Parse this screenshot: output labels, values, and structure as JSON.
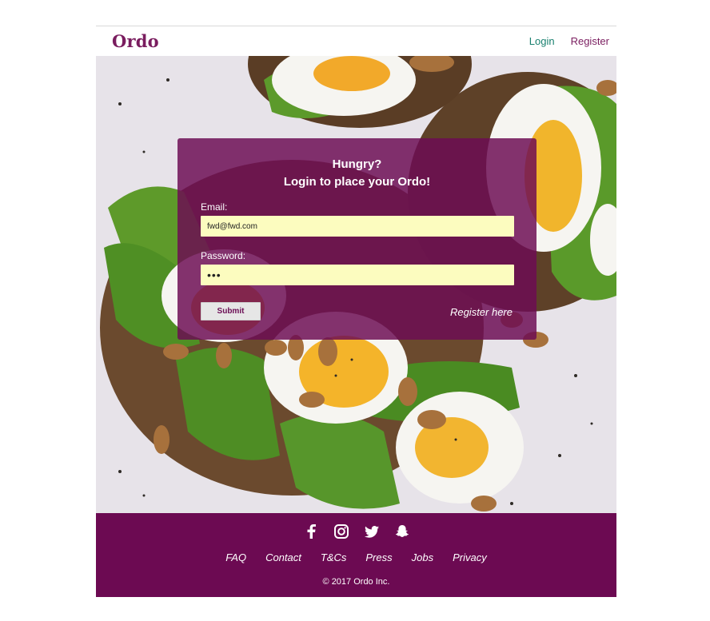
{
  "header": {
    "logo": "Ordo",
    "nav": {
      "login": "Login",
      "register": "Register"
    }
  },
  "hero": {
    "image_icon": "avocado-egg-toast-image"
  },
  "login_card": {
    "title_line1": "Hungry?",
    "title_line2": "Login to place your Ordo!",
    "email_label": "Email:",
    "email_value": "fwd@fwd.com",
    "password_label": "Password:",
    "password_value": "•••",
    "submit_label": "Submit",
    "register_link": "Register here"
  },
  "footer": {
    "social_icons": [
      "facebook-icon",
      "instagram-icon",
      "twitter-icon",
      "snapchat-icon"
    ],
    "links": [
      "FAQ",
      "Contact",
      "T&Cs",
      "Press",
      "Jobs",
      "Privacy"
    ],
    "copyright": "© 2017 Ordo Inc."
  },
  "colors": {
    "brand_purple": "#6c0a52",
    "accent_green": "#19806f",
    "input_yellow": "#fcfcbf"
  }
}
